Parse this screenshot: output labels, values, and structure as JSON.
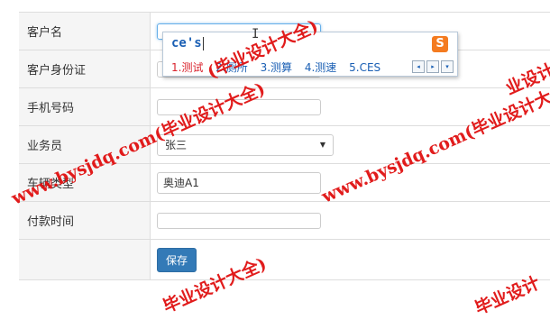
{
  "form": {
    "rows": [
      {
        "label": "客户名",
        "value": ""
      },
      {
        "label": "客户身份证",
        "value": ""
      },
      {
        "label": "手机号码",
        "value": ""
      },
      {
        "label": "业务员",
        "value": "张三"
      },
      {
        "label": "车辆类型",
        "value": "奥迪A1"
      },
      {
        "label": "付款时间",
        "value": ""
      }
    ],
    "save_label": "保存"
  },
  "ime": {
    "composition": "ce's",
    "candidates": [
      "1.测试",
      "2.厕所",
      "3.测算",
      "4.测速",
      "5.CES"
    ],
    "logo": "S",
    "prev": "◂",
    "next": "▸",
    "more": "▾"
  },
  "watermark": {
    "text_a": "www.bysjdq.com(毕业设计大全)",
    "text_b": "毕业设计大全)",
    "text_c": "www.bysjdq.com(毕业设计大全)",
    "text_d": "毕业设计",
    "text_e": "(毕业设计大全)",
    "text_f": "业设计"
  },
  "colors": {
    "primary": "#337ab7",
    "watermark": "#e01010",
    "ime_text": "#1a5fb4"
  }
}
